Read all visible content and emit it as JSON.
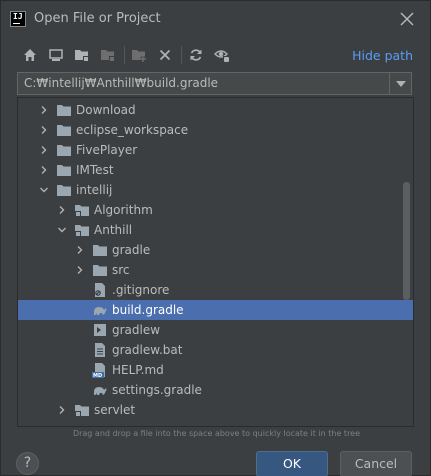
{
  "window": {
    "title": "Open File or Project"
  },
  "toolbar": {
    "hide_path_label": "Hide path"
  },
  "path": {
    "value": "C:₩intellij₩Anthill₩build.gradle"
  },
  "tree": {
    "items": [
      {
        "label": "Download",
        "type": "folder",
        "depth": 1,
        "expanded": false,
        "selected": false
      },
      {
        "label": "eclipse_workspace",
        "type": "folder",
        "depth": 1,
        "expanded": false,
        "selected": false
      },
      {
        "label": "FivePlayer",
        "type": "folder",
        "depth": 1,
        "expanded": false,
        "selected": false
      },
      {
        "label": "IMTest",
        "type": "folder",
        "depth": 1,
        "expanded": false,
        "selected": false
      },
      {
        "label": "intellij",
        "type": "folder",
        "depth": 1,
        "expanded": true,
        "selected": false
      },
      {
        "label": "Algorithm",
        "type": "project-folder",
        "depth": 2,
        "expanded": false,
        "selected": false
      },
      {
        "label": "Anthill",
        "type": "project-folder",
        "depth": 2,
        "expanded": true,
        "selected": false
      },
      {
        "label": "gradle",
        "type": "folder",
        "depth": 3,
        "expanded": false,
        "selected": false
      },
      {
        "label": "src",
        "type": "folder",
        "depth": 3,
        "expanded": false,
        "selected": false
      },
      {
        "label": ".gitignore",
        "type": "file-ignore",
        "depth": 3,
        "leaf": true,
        "selected": false
      },
      {
        "label": "build.gradle",
        "type": "gradle",
        "depth": 3,
        "leaf": true,
        "selected": true
      },
      {
        "label": "gradlew",
        "type": "script",
        "depth": 3,
        "leaf": true,
        "selected": false
      },
      {
        "label": "gradlew.bat",
        "type": "text-file",
        "depth": 3,
        "leaf": true,
        "selected": false
      },
      {
        "label": "HELP.md",
        "type": "markdown",
        "depth": 3,
        "leaf": true,
        "selected": false
      },
      {
        "label": "settings.gradle",
        "type": "gradle",
        "depth": 3,
        "leaf": true,
        "selected": false
      },
      {
        "label": "servlet",
        "type": "project-folder",
        "depth": 2,
        "expanded": false,
        "selected": false
      }
    ]
  },
  "hint": "Drag and drop a file into the space above to quickly locate it in the tree",
  "buttons": {
    "help": "?",
    "ok": "OK",
    "cancel": "Cancel"
  },
  "colors": {
    "background": "#3c3f41",
    "selection": "#4b6eaf",
    "link": "#589df6",
    "ok_button": "#365880",
    "folder": "#9aa7b0"
  }
}
